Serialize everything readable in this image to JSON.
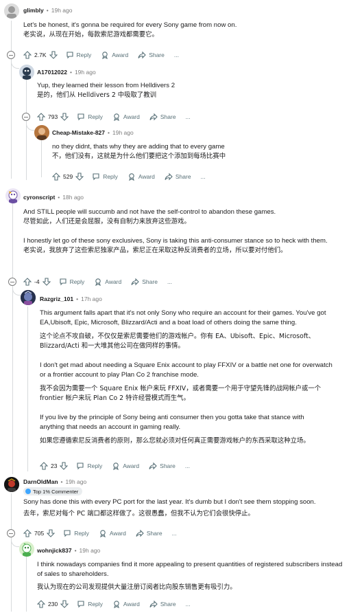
{
  "comments": [
    {
      "username": "glimbly",
      "time": "19h ago",
      "lines": [
        "Let's be honest, it's gonna be required for every Sony game from now on.",
        "老实说，从现在开始，每款索尼游戏都需要它。"
      ],
      "score": "2.7K"
    },
    {
      "username": "A17012022",
      "time": "19h ago",
      "lines": [
        "Yup, they learned their lesson from Helldivers 2",
        "是的，他们从 Helldivers 2 中吸取了教训"
      ],
      "score": "793"
    },
    {
      "username": "Cheap-Mistake-827",
      "time": "19h ago",
      "lines": [
        "no they didnt, thats why they are adding that to every game",
        "不，他们没有，这就是为什么他们要把这个添加到每场比赛中"
      ],
      "score": "529"
    },
    {
      "username": "cyronscript",
      "time": "18h ago",
      "para1": [
        "And STILL people will succumb and not have the self-control to abandon these games.",
        "尽管如此，人们还是会屈服，没有自制力来放弃这些游戏。"
      ],
      "para2": [
        "I honestly let go of these sony exclusives, Sony is taking this anti-consumer stance so to heck with them.",
        "老实说，我放弃了这些索尼独家产品，索尼正在采取这种反消费者的立场，所以要对付他们。"
      ],
      "score": "-4"
    },
    {
      "username": "Razgriz_101",
      "time": "17h ago",
      "para1": [
        "This argument falls apart that it's not only Sony who require an account for their games. You've got",
        "EA,Ubisoft, Epic, Microsoft, Blizzard/Acti and a boat load of others doing the same thing.",
        "这个论点不攻自破，不仅仅是索尼需要他们的游戏帐户。你有 EA、Ubisoft、Epic、Microsoft、",
        "Blizzard/Acti 和一大堆其他公司在做同样的事情。"
      ],
      "para2": [
        "I don't get mad about needing a Square Enix account to play FFXIV or a battle net one for overwatch",
        "or a frontier account to play Plan Co 2 franchise mode.",
        "我不会因为需要一个 Square Enix 帐户来玩 FFXIV，或者需要一个用于守望先锋的战网帐户或一个",
        "frontier 帐户来玩 Plan Co 2 特许经营模式而生气。"
      ],
      "para3": [
        "If you live by the principle of Sony being anti consumer then you gotta take that stance with",
        "anything that needs an account in gaming really.",
        "如果您遵循索尼反消费者的原则，那么您就必须对任何真正需要游戏帐户的东西采取这种立场。"
      ],
      "score": "23"
    },
    {
      "username": "DarnOldMan",
      "time": "19h ago",
      "badge": "Top 1% Commenter",
      "lines": [
        "Sony has done this with every PC port for the last year. It's dumb but I don't see them stopping soon.",
        "去年，索尼对每个 PC 端口都这样做了。这很愚蠢，但我不认为它们会很快停止。"
      ],
      "score": "705"
    },
    {
      "username": "wohnjick837",
      "time": "19h ago",
      "lines": [
        "I think nowadays companies find it more appealing to present quantities of registered subscribers instead",
        "of sales to shareholders.",
        "我认为现在的公司发现提供大量注册订阅者比向股东销售更有吸引力。"
      ],
      "score": "230"
    }
  ],
  "actions": {
    "reply": "Reply",
    "award": "Award",
    "share": "Share",
    "more": "..."
  },
  "icons": {
    "upvote": "upvote-arrow-icon",
    "downvote": "downvote-arrow-icon",
    "reply": "speech-bubble-icon",
    "award": "award-ribbon-icon",
    "share": "share-arrow-icon"
  }
}
